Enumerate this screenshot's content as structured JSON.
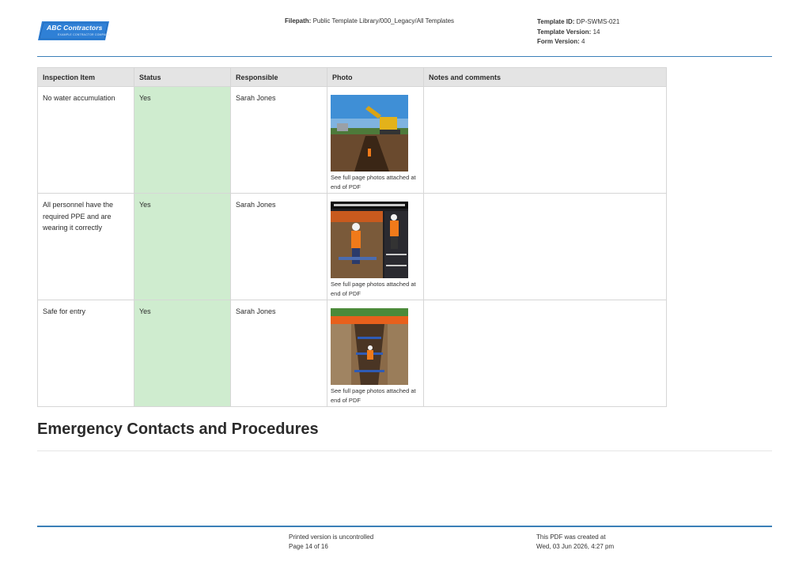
{
  "header": {
    "logo": {
      "name": "ABC Contractors",
      "tagline": "EXAMPLE CONTRACTOR COMPANY"
    },
    "filepath_label": "Filepath:",
    "filepath_value": "Public Template Library/000_Legacy/All Templates",
    "template_id_label": "Template ID:",
    "template_id_value": "DP-SWMS-021",
    "template_version_label": "Template Version:",
    "template_version_value": "14",
    "form_version_label": "Form Version:",
    "form_version_value": "4"
  },
  "table": {
    "headers": [
      "Inspection Item",
      "Status",
      "Responsible",
      "Photo",
      "Notes and comments"
    ],
    "rows": [
      {
        "item": "No water accumulation",
        "status": "Yes",
        "responsible": "Sarah Jones",
        "photo_caption": "See full page photos attached at end of PDF",
        "notes": ""
      },
      {
        "item": "All personnel have the required PPE and are wearing it correctly",
        "status": "Yes",
        "responsible": "Sarah Jones",
        "photo_caption": "See full page photos attached at end of PDF",
        "notes": ""
      },
      {
        "item": "Safe for entry",
        "status": "Yes",
        "responsible": "Sarah Jones",
        "photo_caption": "See full page photos attached at end of PDF",
        "notes": ""
      }
    ]
  },
  "section": {
    "title": "Emergency Contacts and Procedures"
  },
  "footer": {
    "uncontrolled": "Printed version is uncontrolled",
    "page": "Page 14 of 16",
    "created_label": "This PDF was created at",
    "created_date": "Wed, 03 Jun 2026, 4:27 pm"
  },
  "colors": {
    "accent_rule": "#3b7fb8",
    "status_yes": "#cfeccf",
    "header_bg": "#e4e4e4",
    "logo_blue": "#2f80d6"
  }
}
